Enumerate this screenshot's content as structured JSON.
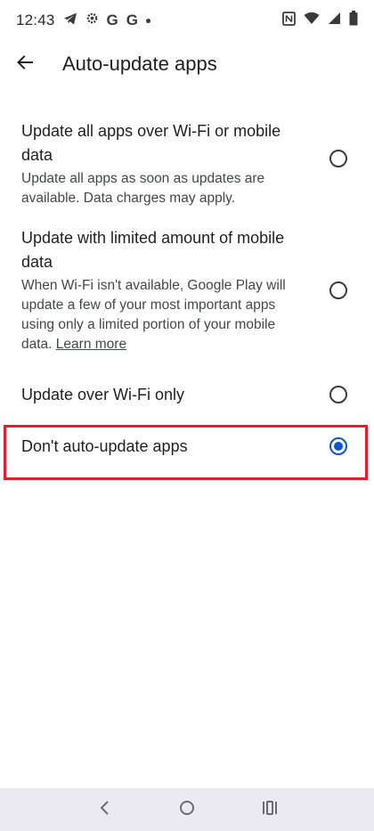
{
  "status_bar": {
    "time": "12:43",
    "notification_icons": [
      "telegram-icon",
      "settings-icon",
      "google-icon",
      "google-icon",
      "more-dot-icon"
    ],
    "g1": "G",
    "g2": "G",
    "system_icons": [
      "nfc-icon",
      "wifi-icon",
      "signal-icon",
      "battery-icon"
    ]
  },
  "app_bar": {
    "back_icon": "arrow-back-icon",
    "title": "Auto-update apps"
  },
  "options": [
    {
      "title": "Update all apps over Wi-Fi or mobile data",
      "description": "Update all apps as soon as updates are available. Data charges may apply.",
      "selected": false
    },
    {
      "title": "Update with limited amount of mobile data",
      "description": "When Wi-Fi isn't available, Google Play will update a few of your most important apps using only a limited portion of your mobile data.",
      "link": "Learn more",
      "selected": false
    },
    {
      "title": "Update over Wi-Fi only",
      "selected": false
    },
    {
      "title": "Don't auto-update apps",
      "selected": true
    }
  ],
  "colors": {
    "accent": "#0b57d0",
    "highlight": "#e0202c",
    "nav_bar": "#eaeaf0"
  },
  "nav_bar": {
    "buttons": [
      "back-nav-icon",
      "home-nav-icon",
      "recents-nav-icon"
    ]
  }
}
